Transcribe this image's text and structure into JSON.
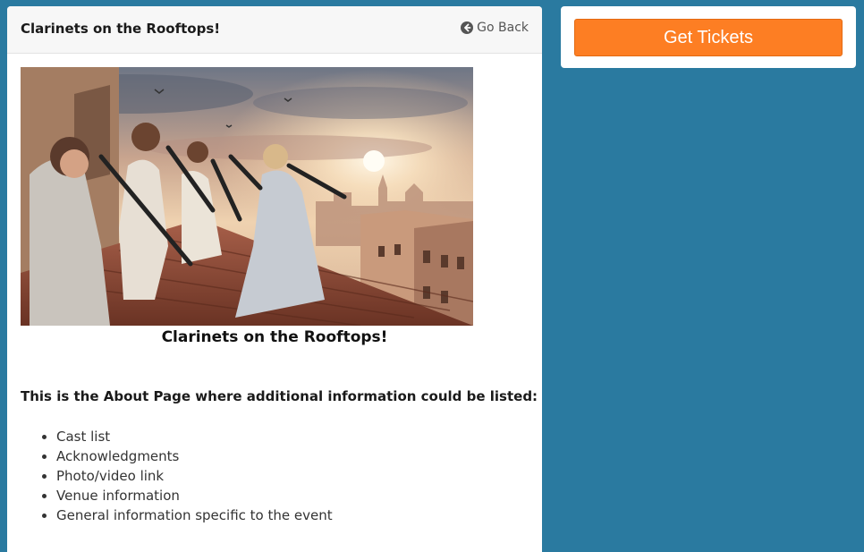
{
  "header": {
    "title": "Clarinets on the Rooftops!",
    "go_back_label": "Go Back"
  },
  "main": {
    "image_caption": "Clarinets on the Rooftops!",
    "about_heading": "This is the About Page where additional information could be listed:",
    "list_items": [
      "Cast list",
      "Acknowledgments",
      "Photo/video link",
      "Venue information",
      "General information specific to the event"
    ]
  },
  "sidebar": {
    "tickets_label": "Get Tickets"
  },
  "colors": {
    "background": "#2a7aa0",
    "tickets_button": "#fd7e23"
  },
  "icons": {
    "go_back": "arrow-circle-left-icon"
  }
}
